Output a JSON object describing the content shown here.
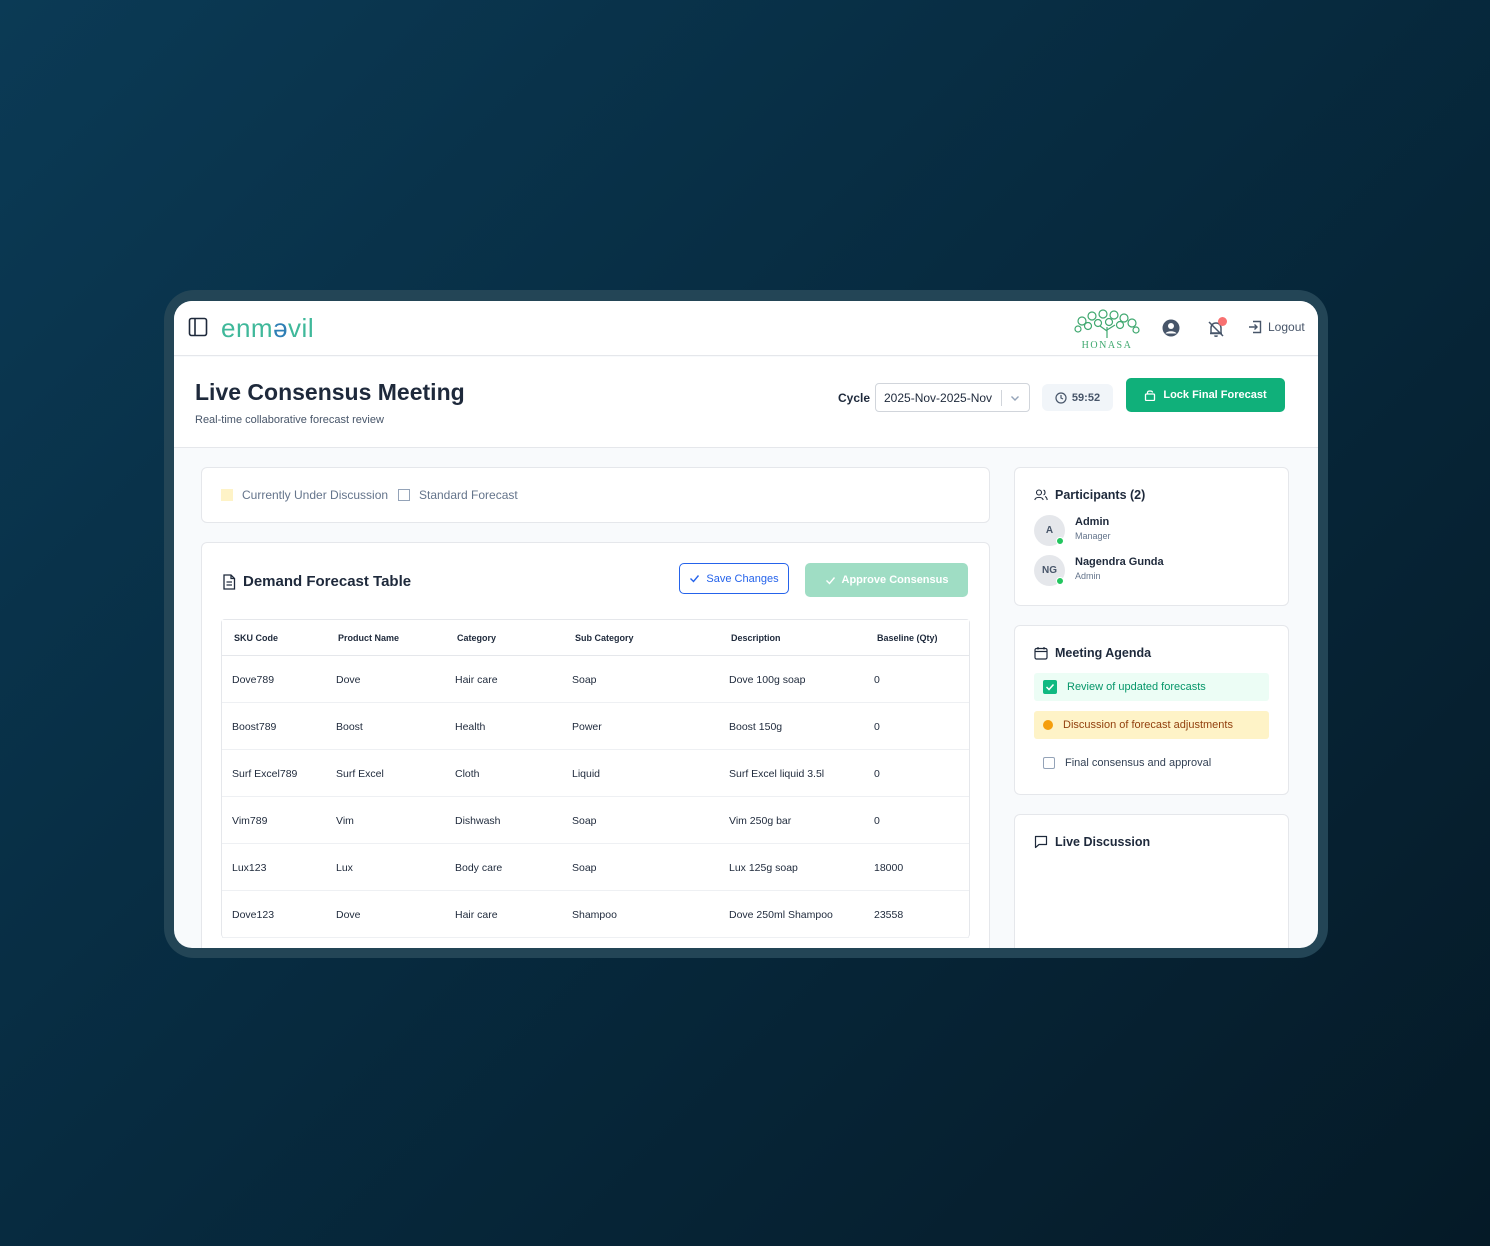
{
  "app": {
    "logo_text_a": "enm",
    "logo_text_o": "ə",
    "logo_text_b": "vil",
    "brand_name": "HONASA",
    "logout_label": "Logout"
  },
  "header": {
    "title": "Live Consensus Meeting",
    "subtitle": "Real-time collaborative forecast review",
    "cycle_label": "Cycle",
    "cycle_value": "2025-Nov-2025-Nov",
    "timer": "59:52",
    "lock_button": "Lock Final Forecast"
  },
  "legend": {
    "under_discussion": "Currently Under Discussion",
    "standard": "Standard Forecast"
  },
  "table": {
    "title": "Demand Forecast Table",
    "save_button": "Save Changes",
    "approve_button": "Approve Consensus",
    "columns": [
      "SKU Code",
      "Product Name",
      "Category",
      "Sub Category",
      "Description",
      "Baseline (Qty)"
    ],
    "rows": [
      [
        "Dove789",
        "Dove",
        "Hair care",
        "Soap",
        "Dove 100g soap",
        "0"
      ],
      [
        "Boost789",
        "Boost",
        "Health",
        "Power",
        "Boost 150g",
        "0"
      ],
      [
        "Surf Excel789",
        "Surf Excel",
        "Cloth",
        "Liquid",
        "Surf Excel liquid 3.5l",
        "0"
      ],
      [
        "Vim789",
        "Vim",
        "Dishwash",
        "Soap",
        "Vim 250g bar",
        "0"
      ],
      [
        "Lux123",
        "Lux",
        "Body care",
        "Soap",
        "Lux 125g soap",
        "18000"
      ],
      [
        "Dove123",
        "Dove",
        "Hair care",
        "Shampoo",
        "Dove 250ml Shampoo",
        "23558"
      ]
    ]
  },
  "participants": {
    "title": "Participants (2)",
    "list": [
      {
        "initials": "A",
        "name": "Admin",
        "role": "Manager"
      },
      {
        "initials": "NG",
        "name": "Nagendra Gunda",
        "role": "Admin"
      }
    ]
  },
  "agenda": {
    "title": "Meeting Agenda",
    "items": [
      {
        "label": "Review of updated forecasts",
        "state": "done"
      },
      {
        "label": "Discussion of forecast adjustments",
        "state": "active"
      },
      {
        "label": "Final consensus and approval",
        "state": "pending"
      }
    ]
  },
  "discussion": {
    "title": "Live Discussion"
  },
  "colors": {
    "primary_green": "#10b07a",
    "save_blue": "#2563eb",
    "active_yellow": "#fef3c7"
  }
}
